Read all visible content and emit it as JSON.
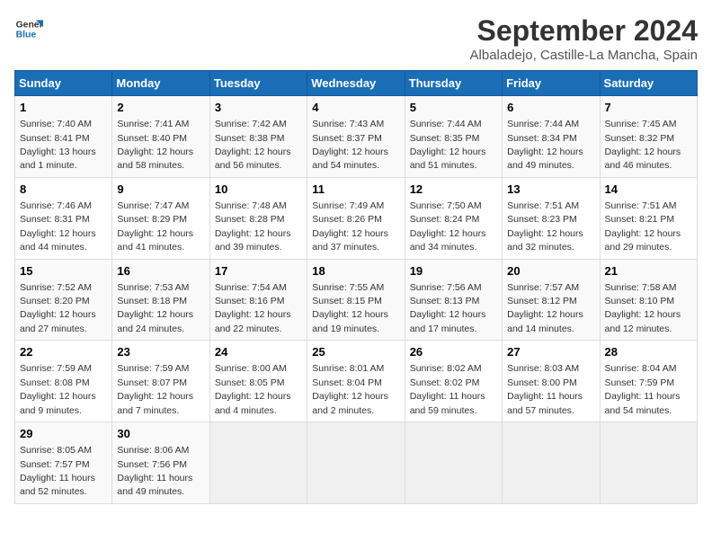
{
  "logo": {
    "line1": "General",
    "line2": "Blue"
  },
  "title": "September 2024",
  "location": "Albaladejo, Castille-La Mancha, Spain",
  "days_of_week": [
    "Sunday",
    "Monday",
    "Tuesday",
    "Wednesday",
    "Thursday",
    "Friday",
    "Saturday"
  ],
  "weeks": [
    [
      {
        "day": "1",
        "sunrise": "7:40 AM",
        "sunset": "8:41 PM",
        "daylight": "13 hours and 1 minute."
      },
      {
        "day": "2",
        "sunrise": "7:41 AM",
        "sunset": "8:40 PM",
        "daylight": "12 hours and 58 minutes."
      },
      {
        "day": "3",
        "sunrise": "7:42 AM",
        "sunset": "8:38 PM",
        "daylight": "12 hours and 56 minutes."
      },
      {
        "day": "4",
        "sunrise": "7:43 AM",
        "sunset": "8:37 PM",
        "daylight": "12 hours and 54 minutes."
      },
      {
        "day": "5",
        "sunrise": "7:44 AM",
        "sunset": "8:35 PM",
        "daylight": "12 hours and 51 minutes."
      },
      {
        "day": "6",
        "sunrise": "7:44 AM",
        "sunset": "8:34 PM",
        "daylight": "12 hours and 49 minutes."
      },
      {
        "day": "7",
        "sunrise": "7:45 AM",
        "sunset": "8:32 PM",
        "daylight": "12 hours and 46 minutes."
      }
    ],
    [
      {
        "day": "8",
        "sunrise": "7:46 AM",
        "sunset": "8:31 PM",
        "daylight": "12 hours and 44 minutes."
      },
      {
        "day": "9",
        "sunrise": "7:47 AM",
        "sunset": "8:29 PM",
        "daylight": "12 hours and 41 minutes."
      },
      {
        "day": "10",
        "sunrise": "7:48 AM",
        "sunset": "8:28 PM",
        "daylight": "12 hours and 39 minutes."
      },
      {
        "day": "11",
        "sunrise": "7:49 AM",
        "sunset": "8:26 PM",
        "daylight": "12 hours and 37 minutes."
      },
      {
        "day": "12",
        "sunrise": "7:50 AM",
        "sunset": "8:24 PM",
        "daylight": "12 hours and 34 minutes."
      },
      {
        "day": "13",
        "sunrise": "7:51 AM",
        "sunset": "8:23 PM",
        "daylight": "12 hours and 32 minutes."
      },
      {
        "day": "14",
        "sunrise": "7:51 AM",
        "sunset": "8:21 PM",
        "daylight": "12 hours and 29 minutes."
      }
    ],
    [
      {
        "day": "15",
        "sunrise": "7:52 AM",
        "sunset": "8:20 PM",
        "daylight": "12 hours and 27 minutes."
      },
      {
        "day": "16",
        "sunrise": "7:53 AM",
        "sunset": "8:18 PM",
        "daylight": "12 hours and 24 minutes."
      },
      {
        "day": "17",
        "sunrise": "7:54 AM",
        "sunset": "8:16 PM",
        "daylight": "12 hours and 22 minutes."
      },
      {
        "day": "18",
        "sunrise": "7:55 AM",
        "sunset": "8:15 PM",
        "daylight": "12 hours and 19 minutes."
      },
      {
        "day": "19",
        "sunrise": "7:56 AM",
        "sunset": "8:13 PM",
        "daylight": "12 hours and 17 minutes."
      },
      {
        "day": "20",
        "sunrise": "7:57 AM",
        "sunset": "8:12 PM",
        "daylight": "12 hours and 14 minutes."
      },
      {
        "day": "21",
        "sunrise": "7:58 AM",
        "sunset": "8:10 PM",
        "daylight": "12 hours and 12 minutes."
      }
    ],
    [
      {
        "day": "22",
        "sunrise": "7:59 AM",
        "sunset": "8:08 PM",
        "daylight": "12 hours and 9 minutes."
      },
      {
        "day": "23",
        "sunrise": "7:59 AM",
        "sunset": "8:07 PM",
        "daylight": "12 hours and 7 minutes."
      },
      {
        "day": "24",
        "sunrise": "8:00 AM",
        "sunset": "8:05 PM",
        "daylight": "12 hours and 4 minutes."
      },
      {
        "day": "25",
        "sunrise": "8:01 AM",
        "sunset": "8:04 PM",
        "daylight": "12 hours and 2 minutes."
      },
      {
        "day": "26",
        "sunrise": "8:02 AM",
        "sunset": "8:02 PM",
        "daylight": "11 hours and 59 minutes."
      },
      {
        "day": "27",
        "sunrise": "8:03 AM",
        "sunset": "8:00 PM",
        "daylight": "11 hours and 57 minutes."
      },
      {
        "day": "28",
        "sunrise": "8:04 AM",
        "sunset": "7:59 PM",
        "daylight": "11 hours and 54 minutes."
      }
    ],
    [
      {
        "day": "29",
        "sunrise": "8:05 AM",
        "sunset": "7:57 PM",
        "daylight": "11 hours and 52 minutes."
      },
      {
        "day": "30",
        "sunrise": "8:06 AM",
        "sunset": "7:56 PM",
        "daylight": "11 hours and 49 minutes."
      },
      null,
      null,
      null,
      null,
      null
    ]
  ]
}
